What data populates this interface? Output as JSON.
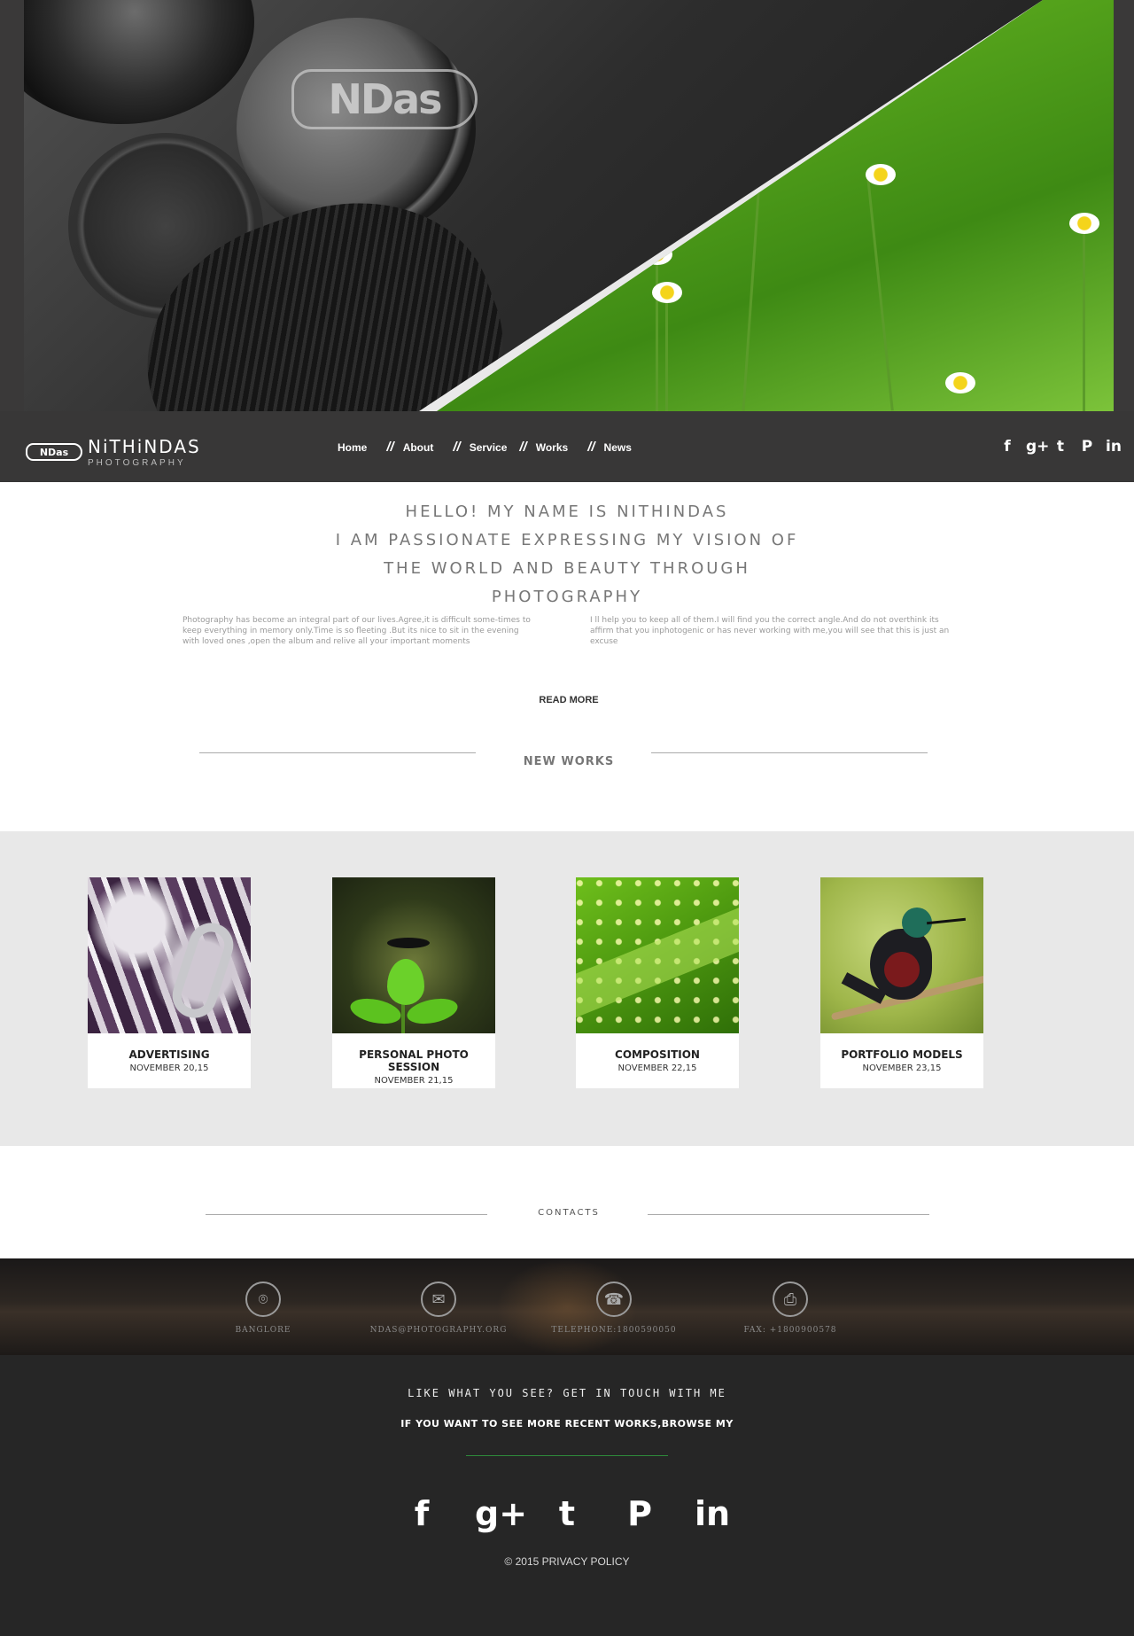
{
  "hero": {
    "logo_text": "NDas"
  },
  "brand": {
    "mark": "NDas",
    "name": "NiTHiNDAS",
    "sub": "PHOTOGRAPHY"
  },
  "nav": {
    "items": [
      {
        "label": "Home"
      },
      {
        "label": "About"
      },
      {
        "label": "Service"
      },
      {
        "label": "Works"
      },
      {
        "label": "News"
      }
    ],
    "separator": "//",
    "social": [
      {
        "icon": "facebook-icon",
        "glyph": "f"
      },
      {
        "icon": "google-plus-icon",
        "glyph": "g+"
      },
      {
        "icon": "twitter-icon",
        "glyph": "t"
      },
      {
        "icon": "pinterest-icon",
        "glyph": "P"
      },
      {
        "icon": "linkedin-icon",
        "glyph": "in"
      }
    ]
  },
  "intro": {
    "heading_lines": [
      "HELLO! MY NAME IS NITHINDAS",
      "I AM PASSIONATE EXPRESSING MY VISION OF",
      "THE WORLD AND BEAUTY THROUGH",
      "PHOTOGRAPHY"
    ],
    "paragraph_left": "Photography has become an integral part of our lives.Agree,it is difficult some-times to keep everything in memory only.Time is so fleeting .But its nice to sit in the evening with loved ones ,open the album and relive all your important moments",
    "paragraph_right": "I ll help you to keep all of them.I will find you the correct angle.And do not overthink its affirm that you inphotogenic or has never working with me,you will see that this is just an excuse",
    "read_more": "READ MORE"
  },
  "new_works": {
    "label": "NEW WORKS",
    "items": [
      {
        "title": "ADVERTISING",
        "date": "NOVEMBER 20,15"
      },
      {
        "title": "PERSONAL PHOTO SESSION",
        "date": "NOVEMBER 21,15"
      },
      {
        "title": "COMPOSITION",
        "date": "NOVEMBER 22,15"
      },
      {
        "title": "PORTFOLIO MODELS",
        "date": "NOVEMBER 23,15"
      }
    ]
  },
  "contacts": {
    "label": "CONTACTS",
    "items": [
      {
        "icon": "location-pin-icon",
        "glyph": "⌾",
        "label": "BANGLORE"
      },
      {
        "icon": "mail-icon",
        "glyph": "✉",
        "label": "NDAS@PHOTOGRAPHY.ORG"
      },
      {
        "icon": "phone-icon",
        "glyph": "☎",
        "label": "TELEPHONE:1800590050"
      },
      {
        "icon": "fax-icon",
        "glyph": "⎙",
        "label": "FAX: +1800900578"
      }
    ]
  },
  "footer": {
    "line1": "LIKE WHAT YOU SEE? GET IN TOUCH WITH ME",
    "line2": "IF YOU WANT TO SEE MORE RECENT WORKS,BROWSE MY",
    "social": [
      {
        "icon": "facebook-icon",
        "glyph": "f"
      },
      {
        "icon": "google-plus-icon",
        "glyph": "g+"
      },
      {
        "icon": "twitter-icon",
        "glyph": "t"
      },
      {
        "icon": "pinterest-icon",
        "glyph": "P"
      },
      {
        "icon": "linkedin-icon",
        "glyph": "in"
      }
    ],
    "copyright": "© 2015  PRIVACY POLICY"
  },
  "colors": {
    "dark_bg": "#262626",
    "nav_bg": "#383737",
    "works_bg": "#e8e8e8",
    "accent_rule": "#2e8a3a"
  }
}
